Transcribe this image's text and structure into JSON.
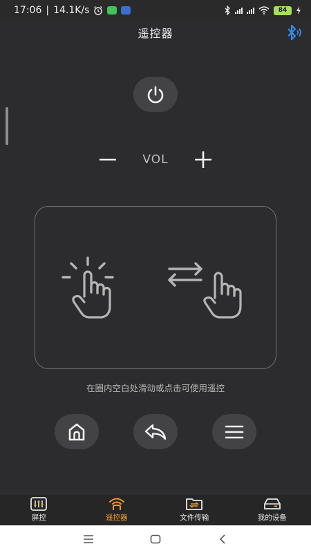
{
  "status_bar": {
    "time": "17:06",
    "speed": "14.1K/s",
    "battery": "84",
    "net1": "HD",
    "net2": "HD"
  },
  "header": {
    "title": "遥控器"
  },
  "controls": {
    "vol_label": "VOL"
  },
  "touchpad": {
    "hint": "在圈内空白处滑动或点击可使用遥控"
  },
  "tabs": [
    {
      "label": "屏控",
      "icon": "equalizer-icon"
    },
    {
      "label": "遥控器",
      "icon": "remote-wifi-icon",
      "active": true
    },
    {
      "label": "文件传输",
      "icon": "folder-transfer-icon"
    },
    {
      "label": "我的设备",
      "icon": "device-icon"
    }
  ],
  "colors": {
    "accent": "#f39a2b",
    "bluetooth": "#2f8ef0",
    "background": "#2c2c2e",
    "button_bg": "#434345"
  }
}
